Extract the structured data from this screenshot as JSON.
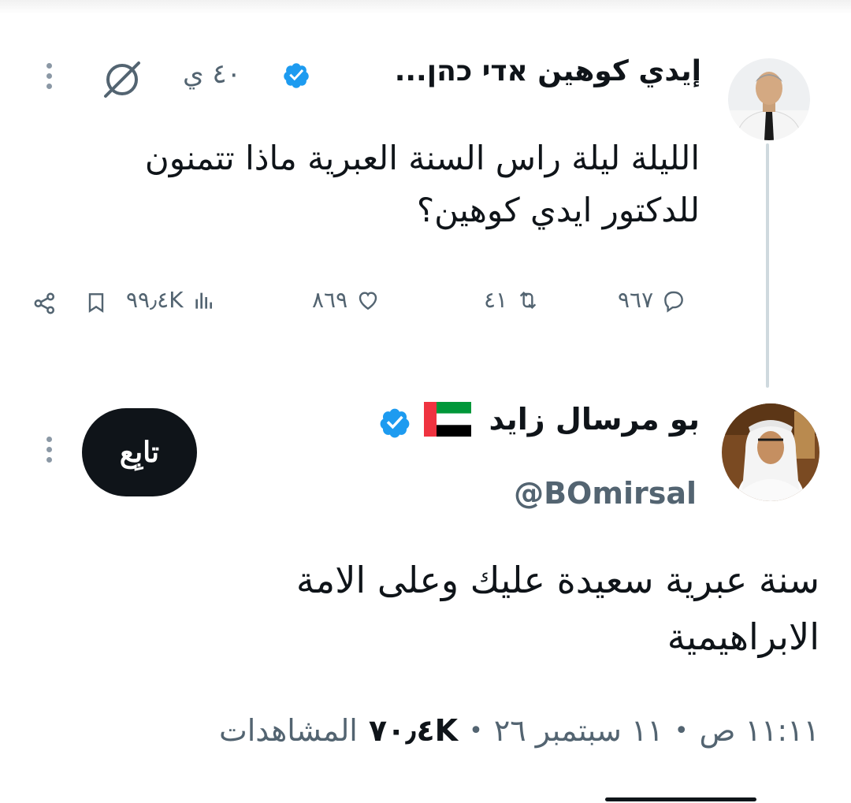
{
  "tweet1": {
    "author_name": "إيدي كوهين אדי כהן...",
    "time": "٤٠ ي",
    "text_line1": "الليلة ليلة راس السنة العبرية ماذا تتمنون",
    "text_line2": "للدكتور ايدي كوهين؟",
    "replies": "٩٦٧",
    "reposts": "٤١",
    "likes": "٨٦٩",
    "views": "٩٩٫٤K"
  },
  "tweet2": {
    "author_name": "بو مرسال زايد",
    "handle": "@BOmirsal",
    "follow_label": "تابِع",
    "text_line1": "سنة عبرية سعيدة عليك وعلى الامة",
    "text_line2": "الابراهيمية",
    "time": "١١:١١ ص",
    "date": "١١ سبتمبر ٢٦",
    "views_count": "٧٠٫٤K",
    "views_label": "المشاهدات"
  },
  "colors": {
    "verified": "#1d9bf0",
    "text": "#0f1419",
    "secondary": "#536471",
    "follow_bg": "#0f1419",
    "uae_red": "#ef3340",
    "uae_green": "#009739"
  },
  "icons": [
    "verified-badge-icon",
    "grok-icon",
    "more-icon",
    "reply-icon",
    "repost-icon",
    "like-icon",
    "views-icon",
    "bookmark-icon",
    "share-icon",
    "uae-flag-icon"
  ]
}
